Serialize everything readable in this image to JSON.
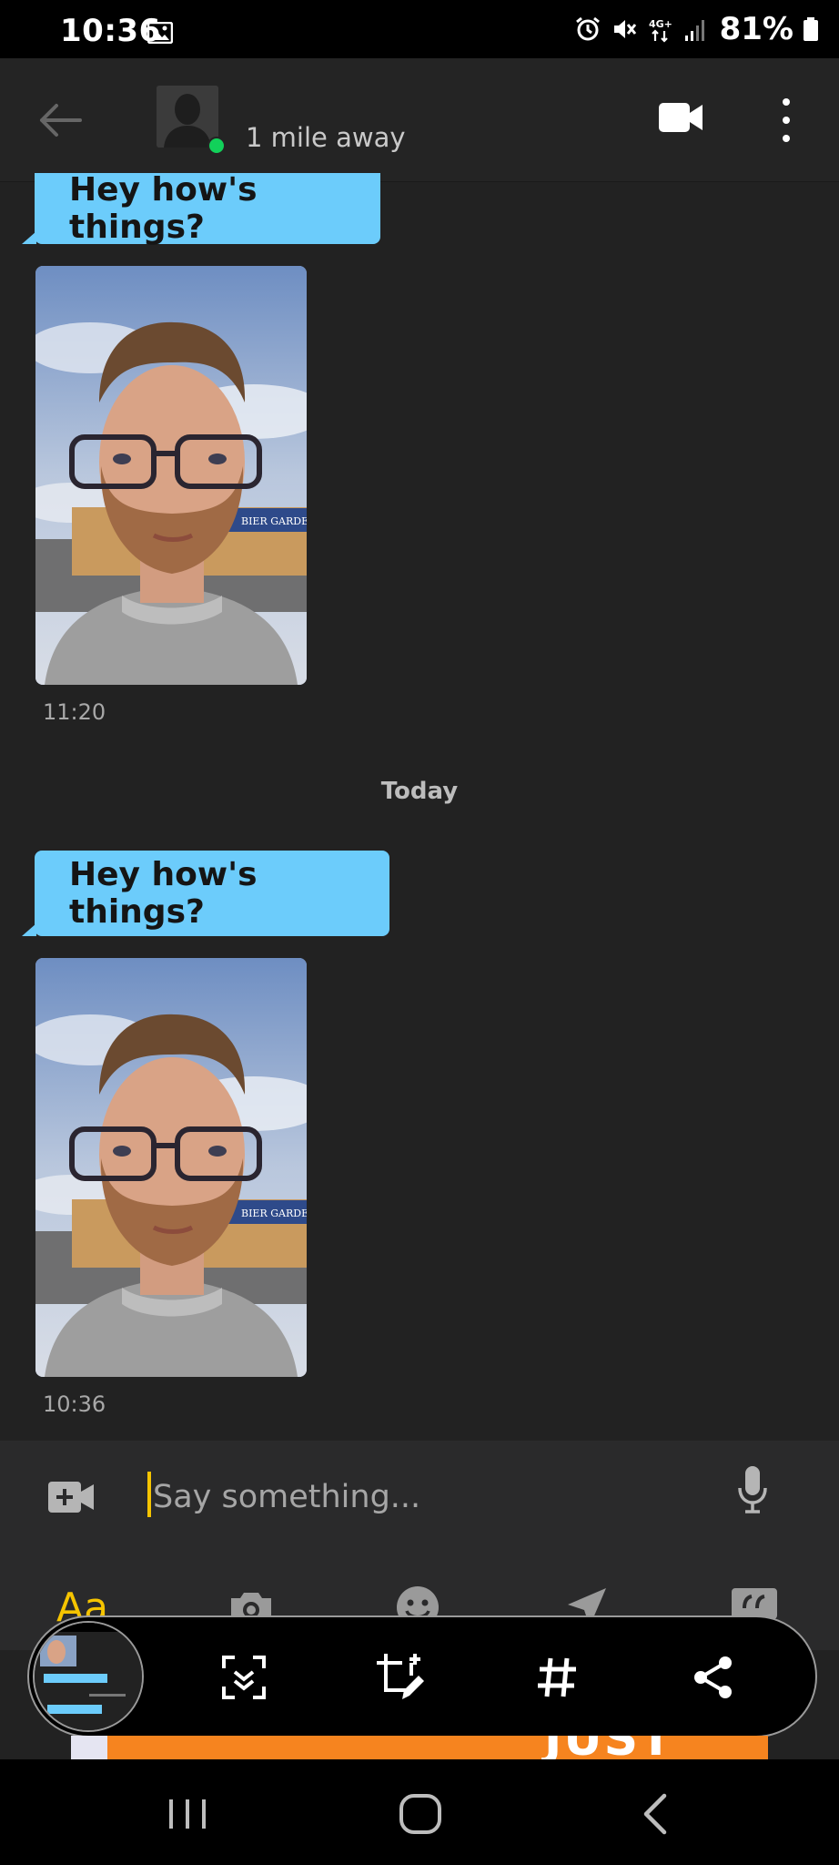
{
  "status_bar": {
    "time": "10:36",
    "battery": "81%",
    "network": "4G+"
  },
  "header": {
    "distance": "1 mile away",
    "online_color": "#12d15a"
  },
  "messages": [
    {
      "type": "text",
      "text": "Hey how's things?"
    },
    {
      "type": "photo",
      "sign_text": "BIER GARDEN",
      "time": "11:20"
    },
    {
      "type": "divider",
      "text": "Today"
    },
    {
      "type": "text",
      "text": "Hey how's things?"
    },
    {
      "type": "photo",
      "sign_text": "BIER GARDEN",
      "time": "10:36"
    }
  ],
  "composer": {
    "placeholder": "Say something...",
    "tools": [
      {
        "name": "text-format",
        "label": "Aa"
      },
      {
        "name": "camera-icon"
      },
      {
        "name": "emoji-icon"
      },
      {
        "name": "location-icon"
      },
      {
        "name": "saved-phrases-icon"
      }
    ]
  },
  "screenshot_toolbar": {
    "buttons": [
      "scroll-capture-icon",
      "crop-edit-icon",
      "tag-icon",
      "share-icon"
    ]
  },
  "ad": {
    "text": "JUST EAT"
  },
  "colors": {
    "bubble": "#6cccfb",
    "accent": "#f5c400",
    "background": "#222222"
  }
}
